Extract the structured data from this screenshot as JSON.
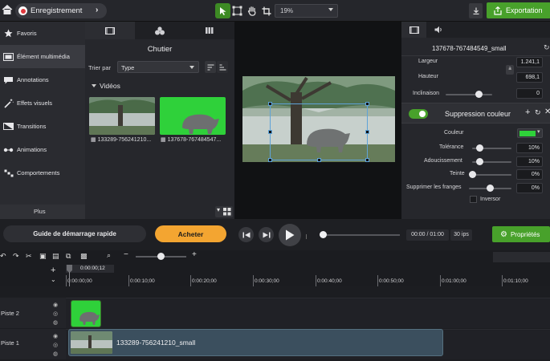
{
  "topbar": {
    "recording_label": "Enregistrement",
    "zoom_value": "19%",
    "export_label": "Exportation"
  },
  "sidebar": {
    "items": [
      {
        "label": "Favoris",
        "icon": "star-icon"
      },
      {
        "label": "Élément multimédia",
        "icon": "film-icon"
      },
      {
        "label": "Annotations",
        "icon": "annotation-icon"
      },
      {
        "label": "Effets visuels",
        "icon": "magic-wand-icon"
      },
      {
        "label": "Transitions",
        "icon": "transition-icon"
      },
      {
        "label": "Animations",
        "icon": "animation-icon"
      },
      {
        "label": "Comportements",
        "icon": "behaviors-icon"
      }
    ],
    "more_label": "Plus"
  },
  "bin": {
    "title": "Chutier",
    "sort_label": "Trier par",
    "sort_value": "Type",
    "section_label": "Vidéos",
    "clips": [
      {
        "name": "133289-756241210..."
      },
      {
        "name": "137678-767484547..."
      }
    ]
  },
  "properties": {
    "clip_title": "137678-767484549_small",
    "width_label": "Largeur",
    "width_value": "1.241,1",
    "height_label": "Hauteur",
    "height_value": "698,1",
    "tilt_label": "Inclinaison",
    "tilt_value": "0",
    "effect_title": "Suppression couleur",
    "color_label": "Couleur",
    "key_color": "#2fd13a",
    "tolerance_label": "Tolérance",
    "tolerance_value": "10%",
    "tolerance_level": 0.1,
    "softness_label": "Adoucissement",
    "softness_value": "10%",
    "softness_level": 0.1,
    "hue_label": "Teinte",
    "hue_value": "0%",
    "hue_level": 0.0,
    "defringe_label": "Supprimer les franges",
    "defringe_value": "0%",
    "defringe_level": 0.0,
    "invert_label": "Inversor"
  },
  "playback": {
    "guide_label": "Guide de démarrage rapide",
    "buy_label": "Acheter",
    "time": "00:00 / 01:00",
    "fps": "30 ips",
    "properties_label": "Propriétés"
  },
  "timeline": {
    "playhead_time": "0:00:00;12",
    "ticks": [
      "0:00:00;00",
      "0:00:10;00",
      "0:00:20;00",
      "0:00:30;00",
      "0:00:40;00",
      "0:00:50;00",
      "0:01:00;00",
      "0:01:10;00"
    ],
    "tracks": [
      {
        "name": "Piste 2"
      },
      {
        "name": "Piste 1",
        "clip_label": "133289-756241210_small"
      }
    ]
  },
  "colors": {
    "accent_green": "#48a12b",
    "buy_orange": "#f3a531",
    "chroma_green": "#2fd13a"
  }
}
